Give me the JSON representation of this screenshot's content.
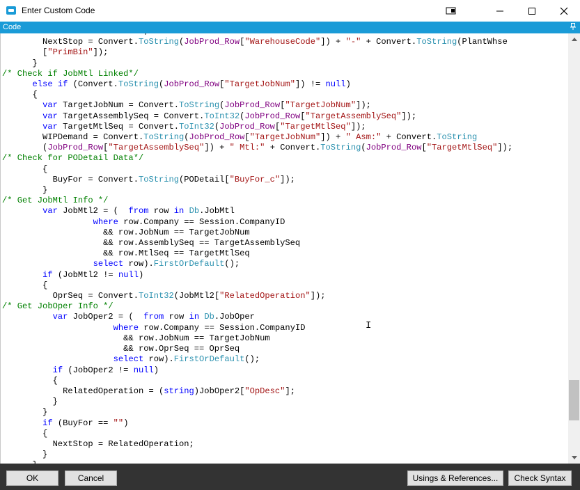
{
  "window": {
    "title": "Enter Custom Code",
    "panel_label": "Code"
  },
  "buttons": {
    "ok": "OK",
    "cancel": "Cancel",
    "usings": "Usings & References...",
    "check_syntax": "Check Syntax"
  },
  "colors": {
    "accent": "#1a9bd7",
    "keyword": "#0000ff",
    "comment": "#008000",
    "string": "#a31515",
    "method": "#2b91af",
    "footer": "#333333"
  },
  "code_lines": [
    [
      [
        "id",
        "        ReceivedTo = \"Stock\";"
      ]
    ],
    [
      [
        "id",
        "        NextStop = Convert."
      ],
      [
        "mt",
        "ToString"
      ],
      [
        "id",
        "("
      ],
      [
        "pl",
        "JobProd_Row"
      ],
      [
        "id",
        "["
      ],
      [
        "st",
        "\"WarehouseCode\""
      ],
      [
        "id",
        "]) + "
      ],
      [
        "st",
        "\"-\""
      ],
      [
        "id",
        " + Convert."
      ],
      [
        "mt",
        "ToString"
      ],
      [
        "id",
        "(PlantWhse"
      ]
    ],
    [
      [
        "id",
        "        ["
      ],
      [
        "st",
        "\"PrimBin\""
      ],
      [
        "id",
        "]);"
      ]
    ],
    [
      [
        "id",
        "      }"
      ]
    ],
    [
      [
        "cm",
        "/* Check if JobMtl Linked*/"
      ]
    ],
    [
      [
        "id",
        "      "
      ],
      [
        "kw",
        "else if"
      ],
      [
        "id",
        " (Convert."
      ],
      [
        "mt",
        "ToString"
      ],
      [
        "id",
        "("
      ],
      [
        "pl",
        "JobProd_Row"
      ],
      [
        "id",
        "["
      ],
      [
        "st",
        "\"TargetJobNum\""
      ],
      [
        "id",
        "]) != "
      ],
      [
        "kw",
        "null"
      ],
      [
        "id",
        ")"
      ]
    ],
    [
      [
        "id",
        "      {"
      ]
    ],
    [
      [
        "id",
        "        "
      ],
      [
        "kw",
        "var"
      ],
      [
        "id",
        " TargetJobNum = Convert."
      ],
      [
        "mt",
        "ToString"
      ],
      [
        "id",
        "("
      ],
      [
        "pl",
        "JobProd_Row"
      ],
      [
        "id",
        "["
      ],
      [
        "st",
        "\"TargetJobNum\""
      ],
      [
        "id",
        "]);"
      ]
    ],
    [
      [
        "id",
        "        "
      ],
      [
        "kw",
        "var"
      ],
      [
        "id",
        " TargetAssemblySeq = Convert."
      ],
      [
        "mt",
        "ToInt32"
      ],
      [
        "id",
        "("
      ],
      [
        "pl",
        "JobProd_Row"
      ],
      [
        "id",
        "["
      ],
      [
        "st",
        "\"TargetAssemblySeq\""
      ],
      [
        "id",
        "]);"
      ]
    ],
    [
      [
        "id",
        "        "
      ],
      [
        "kw",
        "var"
      ],
      [
        "id",
        " TargetMtlSeq = Convert."
      ],
      [
        "mt",
        "ToInt32"
      ],
      [
        "id",
        "("
      ],
      [
        "pl",
        "JobProd_Row"
      ],
      [
        "id",
        "["
      ],
      [
        "st",
        "\"TargetMtlSeq\""
      ],
      [
        "id",
        "]);"
      ]
    ],
    [
      [
        "id",
        "        WIPDemand = Convert."
      ],
      [
        "mt",
        "ToString"
      ],
      [
        "id",
        "("
      ],
      [
        "pl",
        "JobProd_Row"
      ],
      [
        "id",
        "["
      ],
      [
        "st",
        "\"TargetJobNum\""
      ],
      [
        "id",
        "]) + "
      ],
      [
        "st",
        "\" Asm:\""
      ],
      [
        "id",
        " + Convert."
      ],
      [
        "mt",
        "ToString"
      ]
    ],
    [
      [
        "id",
        "        ("
      ],
      [
        "pl",
        "JobProd_Row"
      ],
      [
        "id",
        "["
      ],
      [
        "st",
        "\"TargetAssemblySeq\""
      ],
      [
        "id",
        "]) + "
      ],
      [
        "st",
        "\" Mtl:\""
      ],
      [
        "id",
        " + Convert."
      ],
      [
        "mt",
        "ToString"
      ],
      [
        "id",
        "("
      ],
      [
        "pl",
        "JobProd_Row"
      ],
      [
        "id",
        "["
      ],
      [
        "st",
        "\"TargetMtlSeq\""
      ],
      [
        "id",
        "]);"
      ]
    ],
    [
      [
        "cm",
        "/* Check for PODetail Data*/"
      ]
    ],
    [
      [
        "id",
        "        {"
      ]
    ],
    [
      [
        "id",
        "          BuyFor = Convert."
      ],
      [
        "mt",
        "ToString"
      ],
      [
        "id",
        "(PODetail["
      ],
      [
        "st",
        "\"BuyFor_c\""
      ],
      [
        "id",
        "]);"
      ]
    ],
    [
      [
        "id",
        "        }"
      ]
    ],
    [
      [
        "cm",
        "/* Get JobMtl Info */"
      ]
    ],
    [
      [
        "id",
        "        "
      ],
      [
        "kw",
        "var"
      ],
      [
        "id",
        " JobMtl2 = (  "
      ],
      [
        "kw",
        "from"
      ],
      [
        "id",
        " row "
      ],
      [
        "kw",
        "in"
      ],
      [
        "id",
        " "
      ],
      [
        "mt",
        "Db"
      ],
      [
        "id",
        ".JobMtl"
      ]
    ],
    [
      [
        "id",
        "                  "
      ],
      [
        "kw",
        "where"
      ],
      [
        "id",
        " row.Company == Session.CompanyID"
      ]
    ],
    [
      [
        "id",
        "                    && row.JobNum == TargetJobNum"
      ]
    ],
    [
      [
        "id",
        "                    && row.AssemblySeq == TargetAssemblySeq"
      ]
    ],
    [
      [
        "id",
        "                    && row.MtlSeq == TargetMtlSeq"
      ]
    ],
    [
      [
        "id",
        "                  "
      ],
      [
        "kw",
        "select"
      ],
      [
        "id",
        " row)."
      ],
      [
        "mt",
        "FirstOrDefault"
      ],
      [
        "id",
        "();"
      ]
    ],
    [
      [
        "id",
        "        "
      ],
      [
        "kw",
        "if"
      ],
      [
        "id",
        " (JobMtl2 != "
      ],
      [
        "kw",
        "null"
      ],
      [
        "id",
        ")"
      ]
    ],
    [
      [
        "id",
        "        {"
      ]
    ],
    [
      [
        "id",
        "          OprSeq = Convert."
      ],
      [
        "mt",
        "ToInt32"
      ],
      [
        "id",
        "(JobMtl2["
      ],
      [
        "st",
        "\"RelatedOperation\""
      ],
      [
        "id",
        "]);"
      ]
    ],
    [
      [
        "cm",
        "/* Get JobOper Info */"
      ]
    ],
    [
      [
        "id",
        "          "
      ],
      [
        "kw",
        "var"
      ],
      [
        "id",
        " JobOper2 = (  "
      ],
      [
        "kw",
        "from"
      ],
      [
        "id",
        " row "
      ],
      [
        "kw",
        "in"
      ],
      [
        "id",
        " "
      ],
      [
        "mt",
        "Db"
      ],
      [
        "id",
        ".JobOper"
      ]
    ],
    [
      [
        "id",
        "                      "
      ],
      [
        "kw",
        "where"
      ],
      [
        "id",
        " row.Company == Session.CompanyID"
      ]
    ],
    [
      [
        "id",
        "                        && row.JobNum == TargetJobNum"
      ]
    ],
    [
      [
        "id",
        "                        && row.OprSeq == OprSeq"
      ]
    ],
    [
      [
        "id",
        "                      "
      ],
      [
        "kw",
        "select"
      ],
      [
        "id",
        " row)."
      ],
      [
        "mt",
        "FirstOrDefault"
      ],
      [
        "id",
        "();"
      ]
    ],
    [
      [
        "id",
        "          "
      ],
      [
        "kw",
        "if"
      ],
      [
        "id",
        " (JobOper2 != "
      ],
      [
        "kw",
        "null"
      ],
      [
        "id",
        ")"
      ]
    ],
    [
      [
        "id",
        "          {"
      ]
    ],
    [
      [
        "id",
        "            RelatedOperation = ("
      ],
      [
        "kw",
        "string"
      ],
      [
        "id",
        ")JobOper2["
      ],
      [
        "st",
        "\"OpDesc\""
      ],
      [
        "id",
        "];"
      ]
    ],
    [
      [
        "id",
        "          }"
      ]
    ],
    [
      [
        "id",
        "        }"
      ]
    ],
    [
      [
        "id",
        "        "
      ],
      [
        "kw",
        "if"
      ],
      [
        "id",
        " (BuyFor == "
      ],
      [
        "st",
        "\"\""
      ],
      [
        "id",
        ")"
      ]
    ],
    [
      [
        "id",
        "        {"
      ]
    ],
    [
      [
        "id",
        "          NextStop = RelatedOperation;"
      ]
    ],
    [
      [
        "id",
        "        }"
      ]
    ],
    [
      [
        "id",
        "      }"
      ]
    ]
  ]
}
